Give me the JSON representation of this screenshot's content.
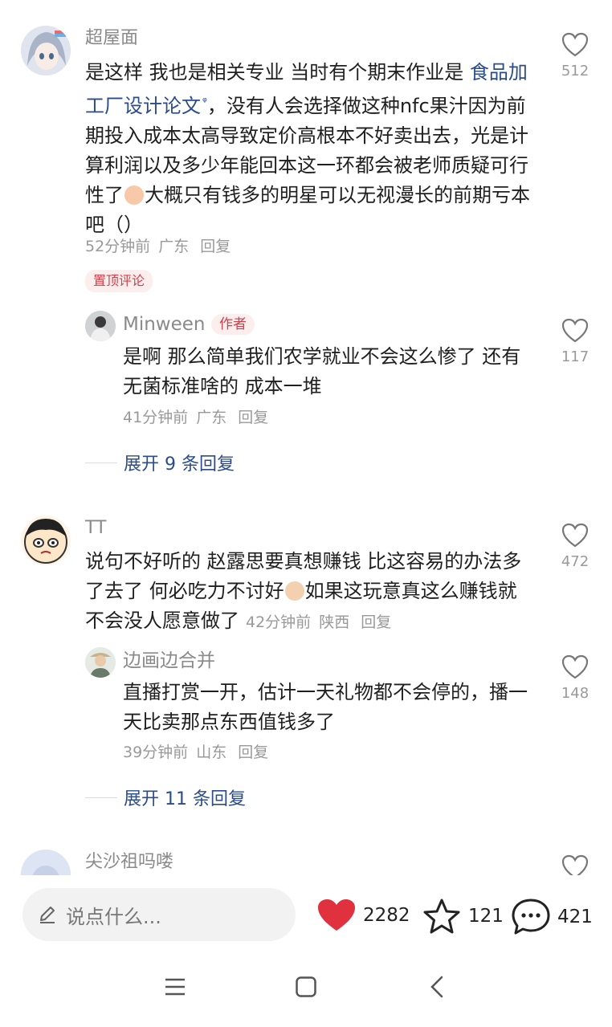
{
  "comments": [
    {
      "username": "超屋面",
      "text_before": "是这样 我也是相关专业 当时有个期末作业是 ",
      "link_text": "食品加工厂设计论文",
      "text_after_link": "，没有人会选择做这种nfc果汁因为前期投入成本太高导致定价高根本不好卖出去，光是计算利润以及多少年能回本这一环都会被老师质疑可行性了",
      "text_after_emoji": "大概只有钱多的明星可以无视漫长的前期亏本吧（）",
      "time": "52分钟前",
      "location": "广东",
      "reply_label": "回复",
      "pinned_label": "置顶评论",
      "likes": "512"
    },
    {
      "username": "Minween",
      "author_tag": "作者",
      "text": "是啊 那么简单我们农学就业不会这么惨了 还有无菌标准啥的 成本一堆",
      "time": "41分钟前",
      "location": "广东",
      "reply_label": "回复",
      "likes": "117",
      "expand_label": "展开 9 条回复"
    },
    {
      "username": "TT",
      "text_before_emoji": "说句不好听的 赵露思要真想赚钱 比这容易的办法多了去了 何必吃力不讨好",
      "text_after_emoji": "如果这玩意真这么赚钱就不会没人愿意做了",
      "time": "42分钟前",
      "location": "陕西",
      "reply_label": "回复",
      "likes": "472"
    },
    {
      "username": "边画边合并",
      "text": "直播打赏一开，估计一天礼物都不会停的，播一天比卖那点东西值钱多了",
      "time": "39分钟前",
      "location": "山东",
      "reply_label": "回复",
      "likes": "148",
      "expand_label": "展开 11 条回复"
    },
    {
      "username": "尖沙祖吗喽"
    }
  ],
  "bottom_bar": {
    "input_placeholder": "说点什么...",
    "likes": "2282",
    "stars": "121",
    "comments": "421"
  },
  "colors": {
    "accent_red": "#e0313e",
    "link_blue": "#2b4c8c"
  }
}
